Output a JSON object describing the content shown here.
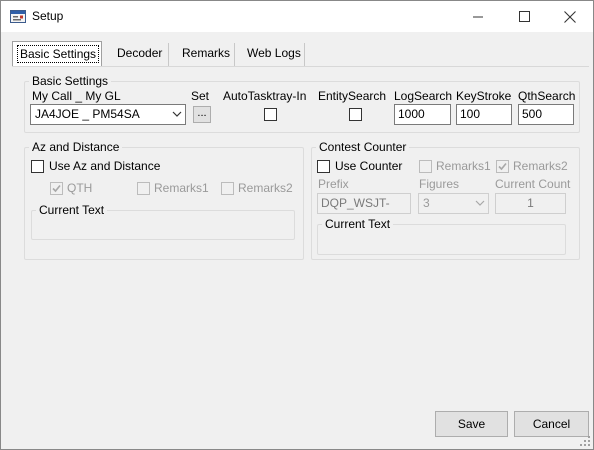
{
  "window": {
    "title": "Setup",
    "icon": "setup-app-icon"
  },
  "tabs": [
    {
      "label": "Basic Settings",
      "active": true
    },
    {
      "label": "Decoder",
      "active": false
    },
    {
      "label": "Remarks",
      "active": false
    },
    {
      "label": "Web Logs",
      "active": false
    }
  ],
  "basic_settings": {
    "legend": "Basic Settings",
    "mycall_label": "My Call _ My GL",
    "mycall_value": "JA4JOE _ PM54SA",
    "set_label": "Set",
    "set_button": "...",
    "autotasktray_label": "AutoTasktray-In",
    "autotasktray_checked": false,
    "entitysearch_label": "EntitySearch",
    "entitysearch_checked": false,
    "logsearch_label": "LogSearch",
    "logsearch_value": "1000",
    "keystroke_label": "KeyStroke",
    "keystroke_value": "100",
    "qthsearch_label": "QthSearch",
    "qthsearch_value": "500"
  },
  "az_distance": {
    "legend": "Az and Distance",
    "use_label": "Use Az and Distance",
    "use_checked": false,
    "qth_label": "QTH",
    "qth_checked": true,
    "remarks1_label": "Remarks1",
    "remarks1_checked": false,
    "remarks2_label": "Remarks2",
    "remarks2_checked": false,
    "current_text_legend": "Current Text"
  },
  "contest_counter": {
    "legend": "Contest Counter",
    "use_label": "Use Counter",
    "use_checked": false,
    "remarks1_label": "Remarks1",
    "remarks1_checked": false,
    "remarks2_label": "Remarks2",
    "remarks2_checked": true,
    "prefix_label": "Prefix",
    "prefix_value": "DQP_WSJT-",
    "figures_label": "Figures",
    "figures_value": "3",
    "current_count_label": "Current Count",
    "current_count_value": "1",
    "current_text_legend": "Current Text"
  },
  "footer": {
    "save_label": "Save",
    "cancel_label": "Cancel"
  }
}
